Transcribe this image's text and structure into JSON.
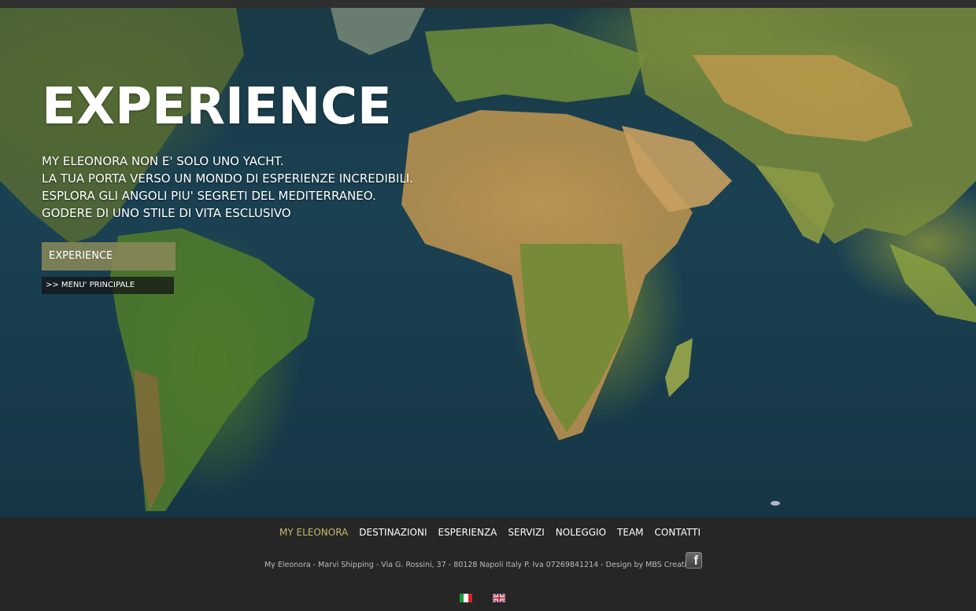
{
  "hero": {
    "title": "EXPERIENCE",
    "lines": [
      "MY ELEONORA NON E' SOLO UNO YACHT.",
      "LA TUA PORTA VERSO UN MONDO DI ESPERIENZE INCREDIBILI.",
      "ESPLORA GLI ANGOLI PIU' SEGRETI DEL MEDITERRANEO.",
      "GODERE DI UNO STILE DI VITA ESCLUSIVO"
    ],
    "primary_button": "EXPERIENCE",
    "secondary_button": ">> MENU' PRINCIPALE"
  },
  "nav": {
    "items": [
      "MY ELEONORA",
      "DESTINAZIONI",
      "ESPERIENZA",
      "SERVIZI",
      "NOLEGGIO",
      "TEAM",
      "CONTATTI"
    ],
    "active_color": "#c9b870"
  },
  "footer": {
    "text": "My Eleonora - Marvi Shipping - Via G. Rossini, 37 - 80128 Napoli Italy P. Iva 07269841214 - Design by MBS Creations",
    "social_icon": "facebook-icon",
    "languages": [
      "italian-flag-icon",
      "english-flag-icon"
    ]
  },
  "colors": {
    "footer_bg": "#262626",
    "primary_button_bg": "#878758",
    "ocean": "#1a4152"
  }
}
